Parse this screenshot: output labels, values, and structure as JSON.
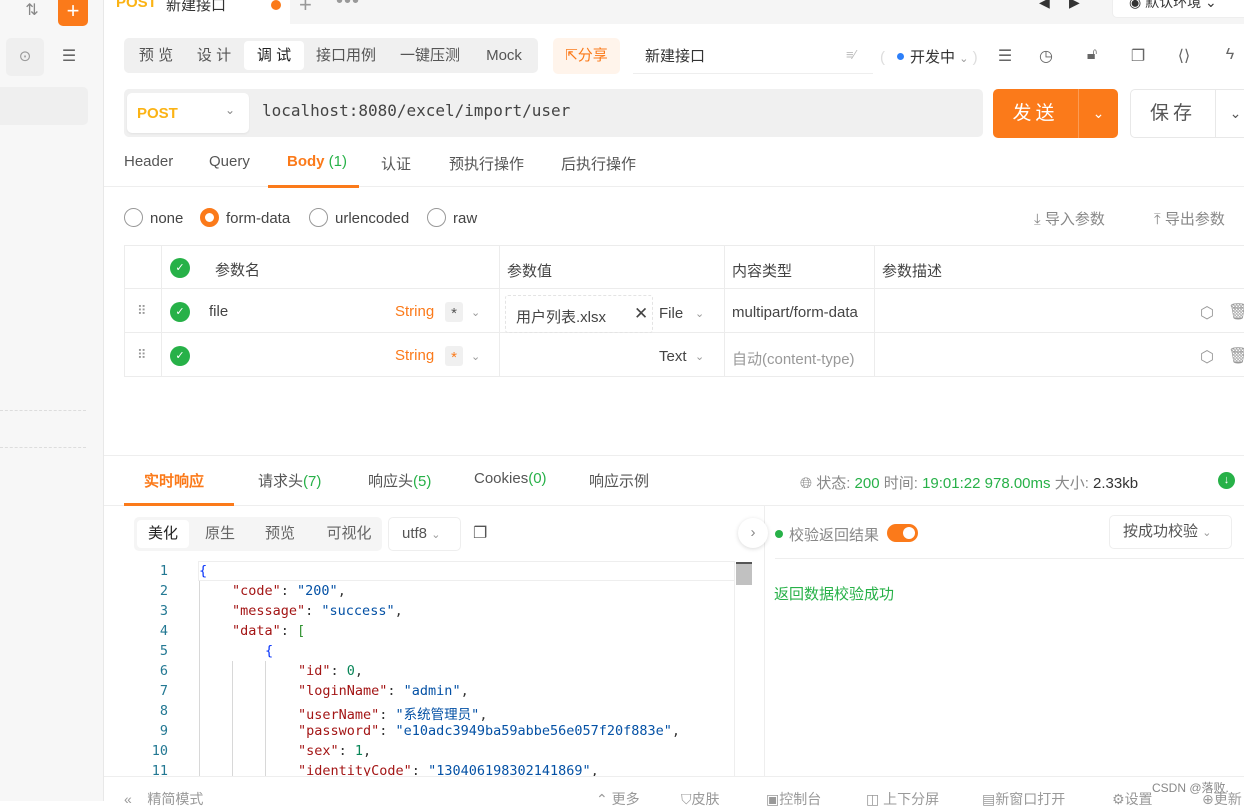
{
  "sidebar": {
    "import_icon": "upload-download-icon",
    "add_icon": "plus-icon",
    "locate_icon": "locate-icon",
    "collapse_icon": "collapse-icon"
  },
  "tabbar": {
    "method": "POST",
    "title": "新建接口",
    "plus": "+",
    "more": "•••",
    "env": "默认环境"
  },
  "mode_tabs": [
    "预 览",
    "设 计",
    "调 试",
    "接口用例",
    "一键压测",
    "Mock"
  ],
  "header": {
    "share": "分享",
    "api_name": "新建接口",
    "status": "开发中"
  },
  "request": {
    "method": "POST",
    "url": "localhost:8080/excel/import/user",
    "send": "发送",
    "save": "保存"
  },
  "request_tabs": [
    {
      "label": "Header"
    },
    {
      "label": "Query"
    },
    {
      "label": "Body",
      "count": "(1)"
    },
    {
      "label": "认证"
    },
    {
      "label": "预执行操作"
    },
    {
      "label": "后执行操作"
    }
  ],
  "body_types": [
    "none",
    "form-data",
    "urlencoded",
    "raw"
  ],
  "body_selected": "form-data",
  "param_actions": {
    "import": "导入参数",
    "export": "导出参数"
  },
  "params": {
    "headers": [
      "参数名",
      "参数值",
      "内容类型",
      "参数描述"
    ],
    "rows": [
      {
        "name": "file",
        "type": "String",
        "required": "*",
        "value": "用户列表.xlsx",
        "value_type": "File",
        "content_type": "multipart/form-data",
        "description": ""
      },
      {
        "name": "",
        "type": "String",
        "required": "*",
        "value": "",
        "value_type": "Text",
        "content_type": "自动(content-type)",
        "description": ""
      }
    ]
  },
  "response": {
    "tabs": [
      {
        "label": "实时响应"
      },
      {
        "label": "请求头",
        "count": "(7)"
      },
      {
        "label": "响应头",
        "count": "(5)"
      },
      {
        "label": "Cookies",
        "count": "(0)"
      },
      {
        "label": "响应示例"
      }
    ],
    "status_label": "状态:",
    "status": "200",
    "time_label": "时间:",
    "time": "19:01:22",
    "duration": "978.00ms",
    "size_label": "大小:",
    "size": "2.33kb",
    "view_tabs": [
      "美化",
      "原生",
      "预览",
      "可视化"
    ],
    "encoding": "utf8",
    "validate_label": "校验返回结果",
    "validate_enabled": true,
    "validate_mode": "按成功校验",
    "validate_result": "返回数据校验成功"
  },
  "code_lines": [
    {
      "n": "1",
      "indent": 0,
      "parts": [
        [
          "b1",
          "{"
        ]
      ]
    },
    {
      "n": "2",
      "indent": 1,
      "parts": [
        [
          "k",
          "\"code\""
        ],
        [
          "p",
          ": "
        ],
        [
          "s",
          "\"200\""
        ],
        [
          "p",
          ","
        ]
      ]
    },
    {
      "n": "3",
      "indent": 1,
      "parts": [
        [
          "k",
          "\"message\""
        ],
        [
          "p",
          ": "
        ],
        [
          "s",
          "\"success\""
        ],
        [
          "p",
          ","
        ]
      ]
    },
    {
      "n": "4",
      "indent": 1,
      "parts": [
        [
          "k",
          "\"data\""
        ],
        [
          "p",
          ": "
        ],
        [
          "b2",
          "["
        ]
      ]
    },
    {
      "n": "5",
      "indent": 2,
      "parts": [
        [
          "b1",
          "{"
        ]
      ]
    },
    {
      "n": "6",
      "indent": 3,
      "parts": [
        [
          "k",
          "\"id\""
        ],
        [
          "p",
          ": "
        ],
        [
          "n",
          "0"
        ],
        [
          "p",
          ","
        ]
      ]
    },
    {
      "n": "7",
      "indent": 3,
      "parts": [
        [
          "k",
          "\"loginName\""
        ],
        [
          "p",
          ": "
        ],
        [
          "s",
          "\"admin\""
        ],
        [
          "p",
          ","
        ]
      ]
    },
    {
      "n": "8",
      "indent": 3,
      "parts": [
        [
          "k",
          "\"userName\""
        ],
        [
          "p",
          ": "
        ],
        [
          "s",
          "\"系统管理员\""
        ],
        [
          "p",
          ","
        ]
      ]
    },
    {
      "n": "9",
      "indent": 3,
      "parts": [
        [
          "k",
          "\"password\""
        ],
        [
          "p",
          ": "
        ],
        [
          "s",
          "\"e10adc3949ba59abbe56e057f20f883e\""
        ],
        [
          "p",
          ","
        ]
      ]
    },
    {
      "n": "10",
      "indent": 3,
      "parts": [
        [
          "k",
          "\"sex\""
        ],
        [
          "p",
          ": "
        ],
        [
          "n",
          "1"
        ],
        [
          "p",
          ","
        ]
      ]
    },
    {
      "n": "11",
      "indent": 3,
      "parts": [
        [
          "k",
          "\"identityCode\""
        ],
        [
          "p",
          ": "
        ],
        [
          "s",
          "\"130406198302141869\""
        ],
        [
          "p",
          ","
        ]
      ]
    }
  ],
  "footer": {
    "simple_mode": "精简模式",
    "more": "更多",
    "skin": "皮肤",
    "console": "控制台",
    "split": "上下分屏",
    "new_window": "新窗口打开",
    "settings": "设置",
    "update": "更新"
  },
  "watermark": "CSDN @落败."
}
